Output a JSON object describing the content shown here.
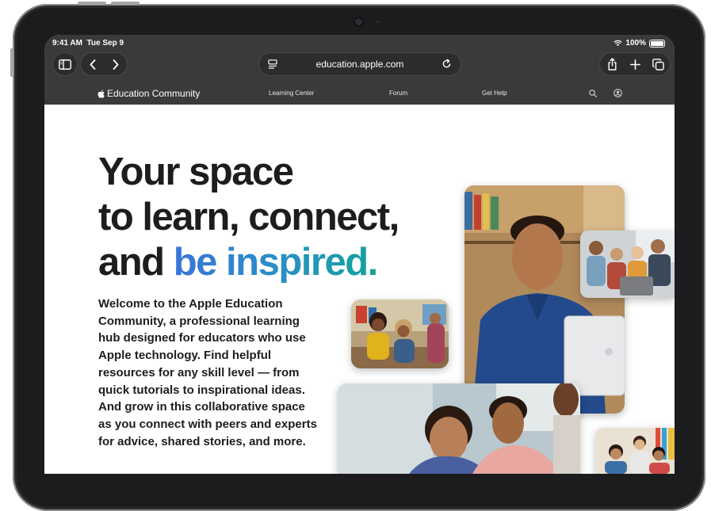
{
  "status_bar": {
    "time": "9:41 AM",
    "date": "Tue Sep 9",
    "battery": "100%"
  },
  "browser": {
    "url": "education.apple.com"
  },
  "site_nav": {
    "logo_text": "Education Community",
    "links": [
      "Learning Center",
      "Forum",
      "Get Help"
    ]
  },
  "hero": {
    "line1": "Your space",
    "line2": "to learn, connect,",
    "line3_plain": "and ",
    "line3_highlight": "be inspired.",
    "intro": "Welcome to the Apple Education Community, a professional learning hub designed for educators who use Apple technology. Find helpful resources for any skill level — from quick tutorials to inspirational ideas. And grow in this collaborative space as you connect with peers and experts for advice, shared stories, and more."
  },
  "colors": {
    "chrome": "#3a3a3c",
    "headline_text": "#1d1d1f",
    "gradient_start": "#3a74d9",
    "gradient_end": "#14a39a"
  },
  "icons": [
    "sidebar-icon",
    "back-icon",
    "forward-icon",
    "page-menu-icon",
    "reload-icon",
    "share-icon",
    "new-tab-icon",
    "tabs-icon",
    "apple-logo-icon",
    "search-icon",
    "account-icon",
    "wifi-icon",
    "battery-icon"
  ]
}
